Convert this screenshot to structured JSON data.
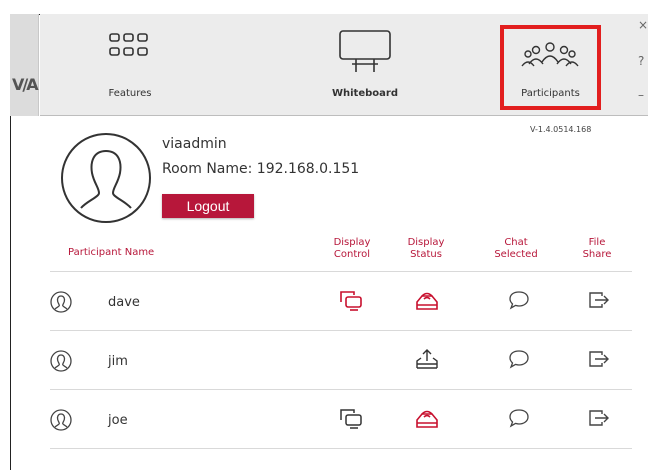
{
  "colors": {
    "accent": "#b7173a",
    "highlight_box": "#e21e1e",
    "toolbar_bg": "#ececec"
  },
  "toolbar": {
    "features_label": "Features",
    "whiteboard_label": "Whiteboard",
    "participants_label": "Participants"
  },
  "window": {
    "close_glyph": "×",
    "help_glyph": "?",
    "minimize_glyph": "–"
  },
  "brand": {
    "logo_text": "V/A"
  },
  "version": "V-1.4.0514.168",
  "profile": {
    "username": "viaadmin",
    "room": "Room Name: 192.168.0.151",
    "logout_label": "Logout"
  },
  "table": {
    "headers": {
      "name": "Participant Name",
      "display_control": [
        "Display",
        "Control"
      ],
      "display_status": [
        "Display",
        "Status"
      ],
      "chat_selected": [
        "Chat",
        "Selected"
      ],
      "file_share": [
        "File",
        "Share"
      ]
    },
    "rows": [
      {
        "name": "dave",
        "display_control": "active",
        "display_status": "presenting",
        "chat": "chat-icon",
        "file_share": "file-share-icon"
      },
      {
        "name": "jim",
        "display_control": "none",
        "display_status": "upload",
        "chat": "chat-icon",
        "file_share": "file-share-icon"
      },
      {
        "name": "joe",
        "display_control": "inactive",
        "display_status": "presenting",
        "chat": "chat-icon",
        "file_share": "file-share-icon"
      }
    ]
  }
}
